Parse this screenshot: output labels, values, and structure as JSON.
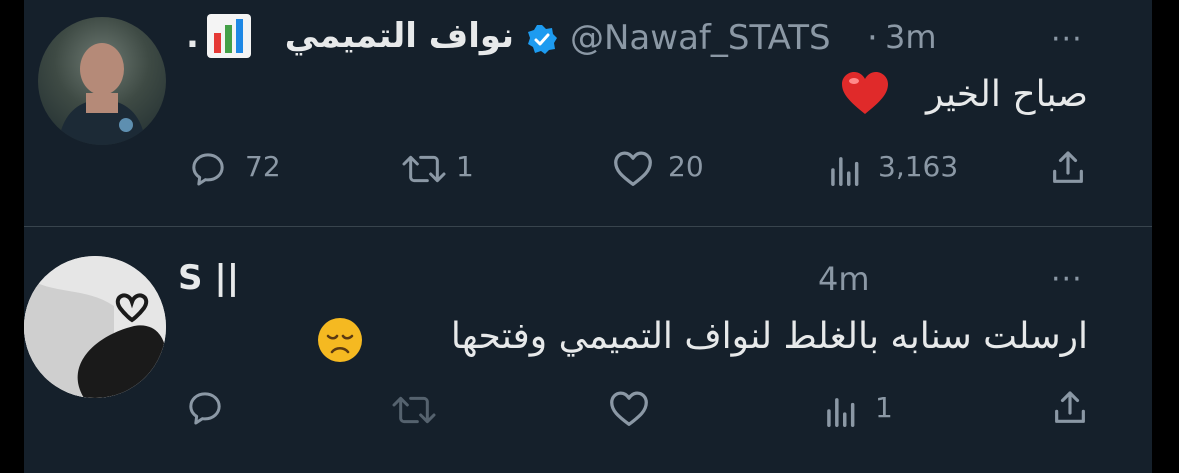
{
  "tweets": [
    {
      "author": {
        "name": "نواف التميمي",
        "handle": "@Nawaf_STATS",
        "prefix": ".",
        "separator": "·",
        "time": "3m"
      },
      "text": "صباح الخير",
      "stats": {
        "replies": "72",
        "retweets": "1",
        "likes": "20",
        "views": "3,163"
      }
    },
    {
      "author": {
        "name": "S ||",
        "time": "4m"
      },
      "text": "ارسلت سنابه بالغلط لنواف التميمي وفتحها",
      "stats": {
        "views": "1"
      }
    }
  ],
  "more_label": "···",
  "colors": {
    "background": "#15202b",
    "muted": "#8b98a5",
    "verified": "#1d9bf0",
    "text": "#e7e9ea"
  },
  "icons": [
    "reply-icon",
    "retweet-icon",
    "like-icon",
    "views-icon",
    "share-icon",
    "verified-badge-icon",
    "chart-emoji-icon",
    "heart-emoji-icon",
    "disappointed-face-emoji-icon"
  ]
}
